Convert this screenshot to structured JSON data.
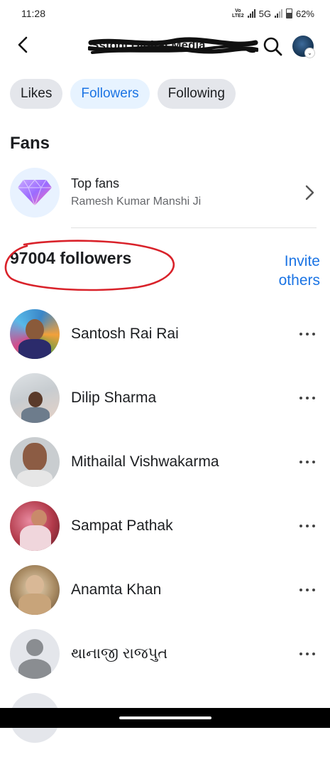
{
  "status_bar": {
    "time": "11:28",
    "network": "5G",
    "volte": "Vo LTE2",
    "battery": "62%"
  },
  "header": {
    "title": "Ssfoni Digital Media"
  },
  "tabs": [
    {
      "label": "Likes",
      "active": false
    },
    {
      "label": "Followers",
      "active": true
    },
    {
      "label": "Following",
      "active": false
    }
  ],
  "fans": {
    "section_title": "Fans",
    "top_fans_label": "Top fans",
    "top_fan_name": "Ramesh Kumar Manshi Ji"
  },
  "followers": {
    "count_label": "97004 followers",
    "invite_line1": "Invite",
    "invite_line2": "others",
    "items": [
      {
        "name": "Santosh Rai Rai"
      },
      {
        "name": "Dilip Sharma"
      },
      {
        "name": "Mithailal Vishwakarma"
      },
      {
        "name": "Sampat Pathak"
      },
      {
        "name": "Anamta Khan"
      },
      {
        "name": "થાનાજી રાજપુત"
      }
    ]
  },
  "colors": {
    "accent": "#1b74e4",
    "annotation": "#d9222a",
    "tab_bg": "#e4e6eb",
    "tab_active_bg": "#e7f3ff"
  }
}
